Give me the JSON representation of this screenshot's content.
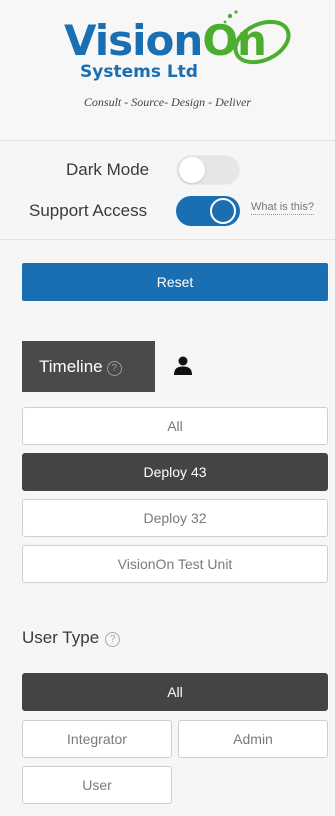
{
  "logo": {
    "brand_vision": "Vision",
    "brand_on": "On",
    "company": "Systems Ltd",
    "tagline": "Consult - Source- Design - Deliver"
  },
  "settings": {
    "dark_mode_label": "Dark Mode",
    "dark_mode_on": false,
    "support_access_label": "Support Access",
    "support_access_on": true,
    "support_help_link": "What is this?"
  },
  "reset_label": "Reset",
  "tabs": {
    "timeline_label": "Timeline",
    "help_glyph": "?",
    "user_icon": "user-icon"
  },
  "timeline_items": [
    "All",
    "Deploy 43",
    "Deploy 32",
    "VisionOn Test Unit"
  ],
  "timeline_selected": "Deploy 43",
  "user_type": {
    "label": "User Type",
    "options": [
      "All",
      "Integrator",
      "Admin",
      "User"
    ],
    "selected": "All"
  },
  "colors": {
    "brand_blue": "#1a6fb3",
    "brand_green": "#4cae2e",
    "active_dark": "#444444"
  }
}
